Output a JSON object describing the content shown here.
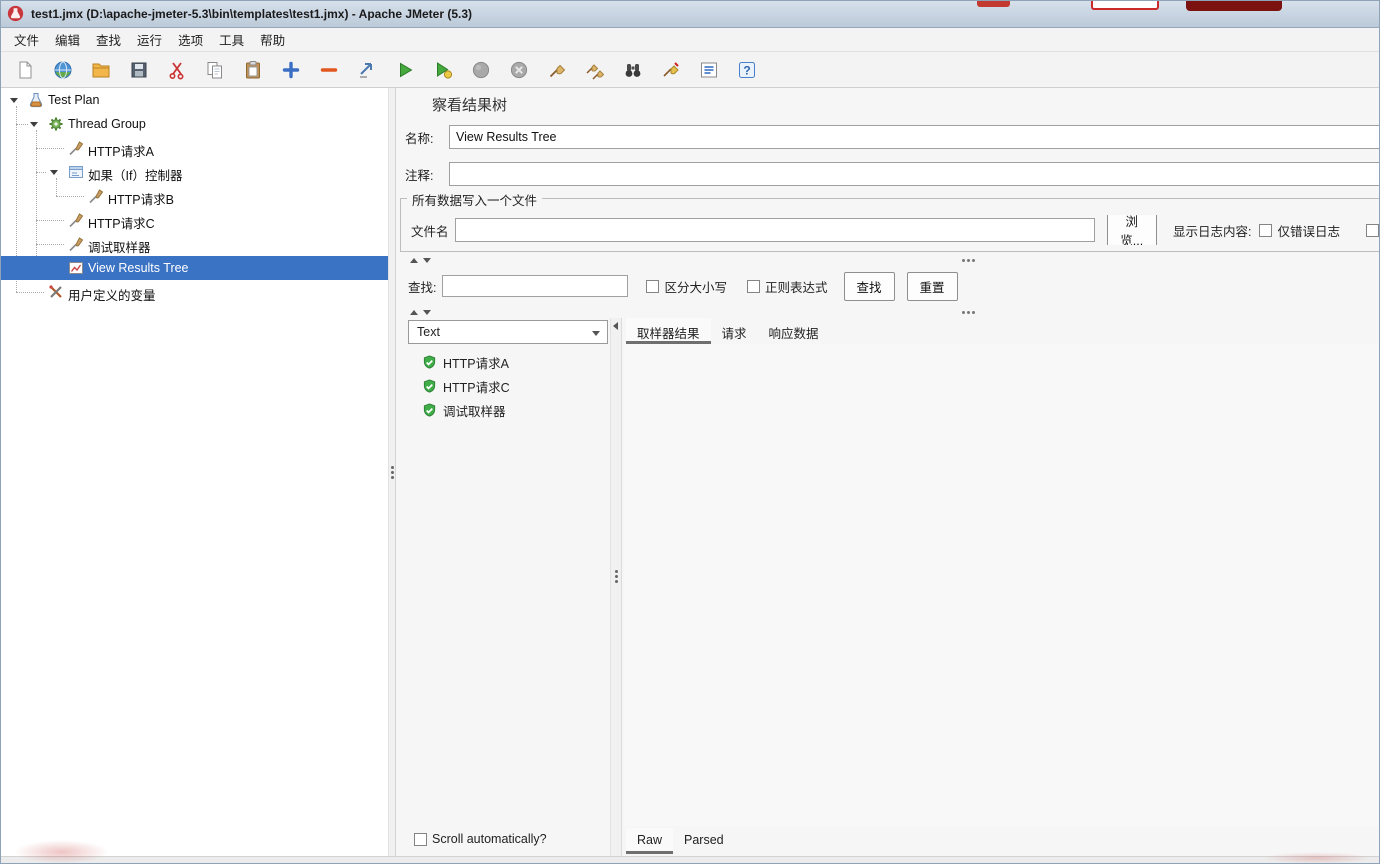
{
  "window": {
    "title": "test1.jmx (D:\\apache-jmeter-5.3\\bin\\templates\\test1.jmx) - Apache JMeter (5.3)"
  },
  "menu": {
    "items": [
      "文件",
      "编辑",
      "查找",
      "运行",
      "选项",
      "工具",
      "帮助"
    ]
  },
  "toolbar": {
    "icons": [
      "new",
      "templates",
      "open",
      "save",
      "cut",
      "copy",
      "paste",
      "expand-all",
      "collapse-all",
      "toggle",
      "start",
      "start-no-pauses",
      "stop",
      "shutdown",
      "clear",
      "clear-all",
      "search",
      "search-reset",
      "function-helper",
      "help"
    ]
  },
  "tree": {
    "items": [
      {
        "label": "Test Plan",
        "icon": "test-plan-icon",
        "level": 0,
        "expanded": true,
        "selected": false
      },
      {
        "label": "Thread Group",
        "icon": "thread-group-icon",
        "level": 1,
        "expanded": true,
        "selected": false
      },
      {
        "label": "HTTP请求A",
        "icon": "http-request-icon",
        "level": 2,
        "selected": false
      },
      {
        "label": "如果（If）控制器",
        "icon": "if-controller-icon",
        "level": 2,
        "expanded": true,
        "selected": false
      },
      {
        "label": "HTTP请求B",
        "icon": "http-request-icon",
        "level": 3,
        "selected": false
      },
      {
        "label": "HTTP请求C",
        "icon": "http-request-icon",
        "level": 2,
        "selected": false
      },
      {
        "label": "调试取样器",
        "icon": "debug-sampler-icon",
        "level": 2,
        "selected": false
      },
      {
        "label": "View Results Tree",
        "icon": "view-results-tree-icon",
        "level": 2,
        "selected": true
      },
      {
        "label": "用户定义的变量",
        "icon": "user-defined-variables-icon",
        "level": 1,
        "selected": false
      }
    ]
  },
  "panel": {
    "title": "察看结果树",
    "name_label": "名称:",
    "name_value": "View Results Tree",
    "comment_label": "注释:",
    "comment_value": "",
    "file_group": {
      "title": "所有数据写入一个文件",
      "filename_label": "文件名",
      "filename_value": "",
      "browse_button": "浏览...",
      "log_content_label": "显示日志内容:",
      "errors_only_label": "仅错误日志"
    },
    "search": {
      "label": "查找:",
      "value": "",
      "case_sensitive_label": "区分大小写",
      "regex_label": "正则表达式",
      "find_button": "查找",
      "reset_button": "重置"
    },
    "viewer": {
      "renderer": "Text",
      "results": [
        {
          "label": "HTTP请求A",
          "icon": "success-shield-icon"
        },
        {
          "label": "HTTP请求C",
          "icon": "success-shield-icon"
        },
        {
          "label": "调试取样器",
          "icon": "success-shield-icon"
        }
      ],
      "scroll_label": "Scroll automatically?"
    },
    "tabs": [
      "取样器结果",
      "请求",
      "响应数据"
    ],
    "raw_tabs": [
      "Raw",
      "Parsed"
    ]
  }
}
